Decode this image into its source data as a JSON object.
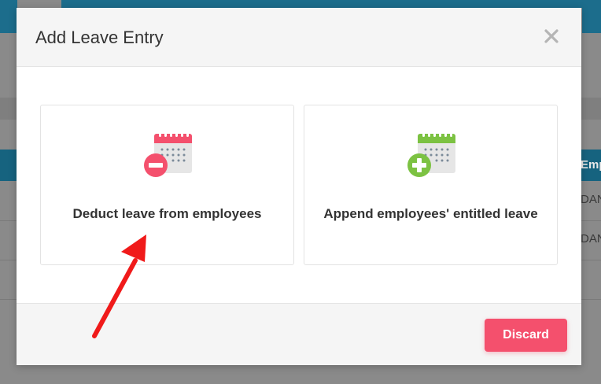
{
  "modal": {
    "title": "Add Leave Entry",
    "close_icon": "close-icon",
    "options": [
      {
        "label": "Deduct leave from employees",
        "icon": "calendar-minus-icon",
        "accent": "#f4506d"
      },
      {
        "label": "Append employees' entitled leave",
        "icon": "calendar-plus-icon",
        "accent": "#7cc242"
      }
    ],
    "discard_label": "Discard"
  },
  "background": {
    "table_header_partial": "Emp",
    "rows": [
      "DAN",
      "DAN"
    ]
  },
  "colors": {
    "accent_red": "#f4506d",
    "accent_green": "#7cc242",
    "header_blue": "#16637f"
  }
}
